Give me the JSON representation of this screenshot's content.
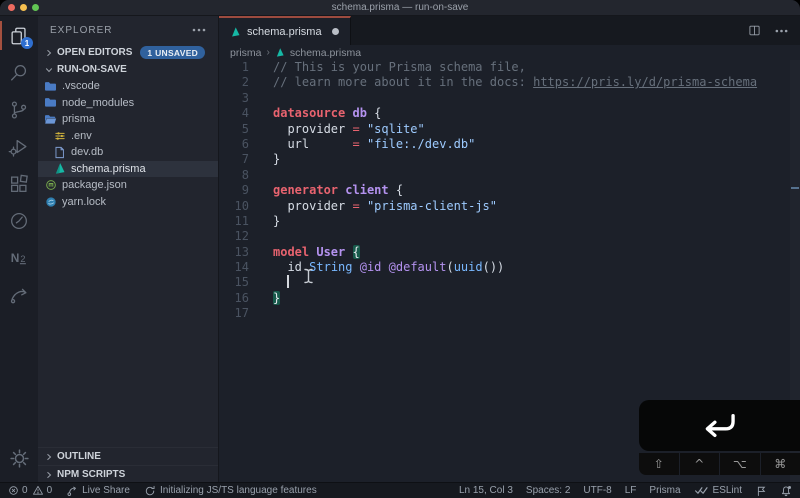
{
  "window": {
    "title": "schema.prisma — run-on-save",
    "traffic_lights": [
      "close",
      "minimize",
      "zoom"
    ]
  },
  "colors": {
    "accent_active_border": "#9d4b3f",
    "badge_blue": "#2f6fd0",
    "unsaved_badge_blue": "#30619d",
    "prisma_teal": "#16b8a5",
    "keyword_red": "#e8636f",
    "string_blue": "#9ecbff",
    "type_blue": "#79b8ff",
    "entity_purple": "#b492ef",
    "traffic_red": "#ed6b60",
    "traffic_yellow": "#f5bf4f",
    "traffic_green": "#62c554"
  },
  "activity_bar": {
    "badge": "1",
    "items": [
      "explorer-icon",
      "search-icon",
      "source-control-icon",
      "run-debug-icon",
      "extensions-icon",
      "wakatime-clock-icon",
      "n2-extension-icon",
      "swoosh-extension-icon",
      "settings-gear-icon"
    ]
  },
  "sidebar": {
    "title": "EXPLORER",
    "open_editors": "OPEN EDITORS",
    "unsaved_badge": "1 UNSAVED",
    "workspace": "RUN-ON-SAVE",
    "outline": "OUTLINE",
    "npm_scripts": "NPM SCRIPTS",
    "files": [
      {
        "name": ".vscode",
        "icon": "folder",
        "nested": false,
        "selected": false
      },
      {
        "name": "node_modules",
        "icon": "folder",
        "nested": false,
        "selected": false
      },
      {
        "name": "prisma",
        "icon": "folder-open",
        "nested": false,
        "selected": false
      },
      {
        "name": ".env",
        "icon": "env",
        "nested": true,
        "selected": false
      },
      {
        "name": "dev.db",
        "icon": "db",
        "nested": true,
        "selected": false
      },
      {
        "name": "schema.prisma",
        "icon": "prisma",
        "nested": true,
        "selected": true
      },
      {
        "name": "package.json",
        "icon": "npm",
        "nested": false,
        "selected": false
      },
      {
        "name": "yarn.lock",
        "icon": "yarn",
        "nested": false,
        "selected": false
      }
    ]
  },
  "editor": {
    "tab_label": "schema.prisma",
    "modified": true,
    "breadcrumb_folder": "prisma",
    "breadcrumb_file": "schema.prisma",
    "code_lines": [
      [
        [
          "comment",
          "// This is your Prisma schema file,"
        ]
      ],
      [
        [
          "comment",
          "// learn more about it in the docs: "
        ],
        [
          "link",
          "https://pris.ly/d/prisma-schema"
        ]
      ],
      [],
      [
        [
          "keyword",
          "datasource"
        ],
        [
          "plain",
          " "
        ],
        [
          "entity",
          "db"
        ],
        [
          "plain",
          " {"
        ]
      ],
      [
        [
          "plain",
          "  "
        ],
        [
          "property",
          "provider"
        ],
        [
          "plain",
          " "
        ],
        [
          "operator",
          "="
        ],
        [
          "plain",
          " "
        ],
        [
          "string",
          "\"sqlite\""
        ]
      ],
      [
        [
          "plain",
          "  "
        ],
        [
          "property",
          "url"
        ],
        [
          "plain",
          "      "
        ],
        [
          "operator",
          "="
        ],
        [
          "plain",
          " "
        ],
        [
          "string",
          "\"file:./dev.db\""
        ]
      ],
      [
        [
          "plain",
          "}"
        ]
      ],
      [],
      [
        [
          "keyword",
          "generator"
        ],
        [
          "plain",
          " "
        ],
        [
          "entity",
          "client"
        ],
        [
          "plain",
          " {"
        ]
      ],
      [
        [
          "plain",
          "  "
        ],
        [
          "property",
          "provider"
        ],
        [
          "plain",
          " "
        ],
        [
          "operator",
          "="
        ],
        [
          "plain",
          " "
        ],
        [
          "string",
          "\"prisma-client-js\""
        ]
      ],
      [
        [
          "plain",
          "}"
        ]
      ],
      [],
      [
        [
          "keyword",
          "model"
        ],
        [
          "plain",
          " "
        ],
        [
          "entity",
          "User"
        ],
        [
          "plain",
          " "
        ],
        [
          "bracket",
          "{"
        ]
      ],
      [
        [
          "plain",
          "  "
        ],
        [
          "property",
          "id"
        ],
        [
          "plain",
          " "
        ],
        [
          "type",
          "String"
        ],
        [
          "plain",
          " "
        ],
        [
          "attr",
          "@id"
        ],
        [
          "plain",
          " "
        ],
        [
          "attr",
          "@default"
        ],
        [
          "plain",
          "("
        ],
        [
          "func",
          "uuid"
        ],
        [
          "plain",
          "())"
        ]
      ],
      [
        [
          "plain",
          "  "
        ],
        [
          "caret",
          ""
        ]
      ],
      [
        [
          "bracket",
          "}"
        ]
      ],
      []
    ]
  },
  "status_bar": {
    "errors": "0",
    "warnings": "0",
    "live_share": "Live Share",
    "message": "Initializing JS/TS language features",
    "cursor_position": "Ln 15, Col 3",
    "indentation": "Spaces: 2",
    "encoding": "UTF-8",
    "eol": "LF",
    "language": "Prisma",
    "linter": "ESLint",
    "icons": [
      "error-icon",
      "warning-icon",
      "live-share-icon",
      "sync-spinner-icon",
      "eslint-checks-icon",
      "feedback-icon",
      "notifications-bell-icon"
    ]
  },
  "keycastr": {
    "pressed_key_icon": "return-key-icon",
    "modifiers": [
      "⇧",
      "^",
      "⌥",
      "⌘"
    ]
  }
}
